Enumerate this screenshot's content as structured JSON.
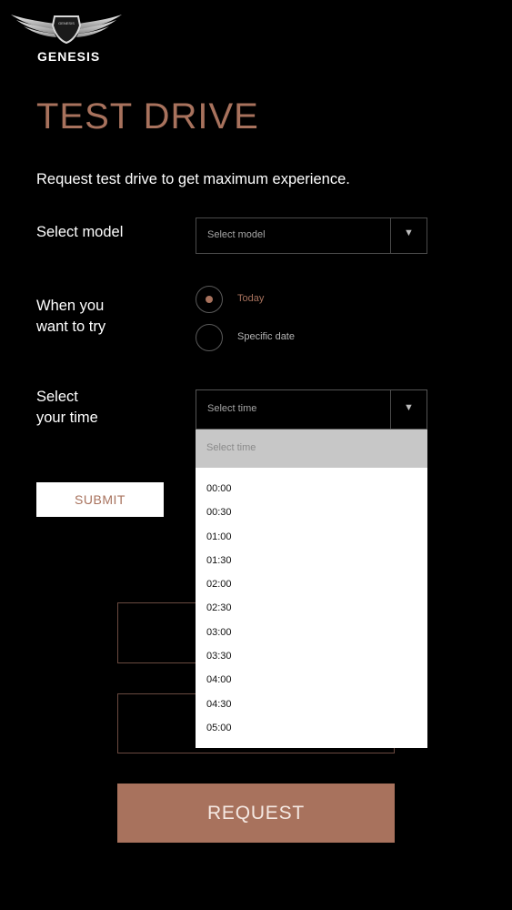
{
  "header": {
    "brand": "GENESIS",
    "emblem_text": "GENESIS"
  },
  "page": {
    "title": "TEST DRIVE",
    "subtitle": "Request test drive to get maximum experience."
  },
  "form": {
    "model_label": "Select model",
    "model_select": {
      "value": "Select model",
      "arrow": "▼"
    },
    "when_label_line1": "When you",
    "when_label_line2": "want to try",
    "radio_today": "Today",
    "radio_specific": "Specific date",
    "radio_selected": "Today",
    "time_label_line1": "Select",
    "time_label_line2": "your time",
    "time_select": {
      "value": "Select time",
      "arrow": "▼"
    },
    "submit_label": "SUBMIT"
  },
  "dropdown": {
    "header": "Select time",
    "options": [
      "00:00",
      "00:30",
      "01:00",
      "01:30",
      "02:00",
      "02:30",
      "03:00",
      "03:30",
      "04:00",
      "04:30",
      "05:00"
    ]
  },
  "request_label": "REQUEST",
  "colors": {
    "accent": "#a8725d",
    "background": "#000000",
    "dropdown_header": "#c7c7c7"
  }
}
